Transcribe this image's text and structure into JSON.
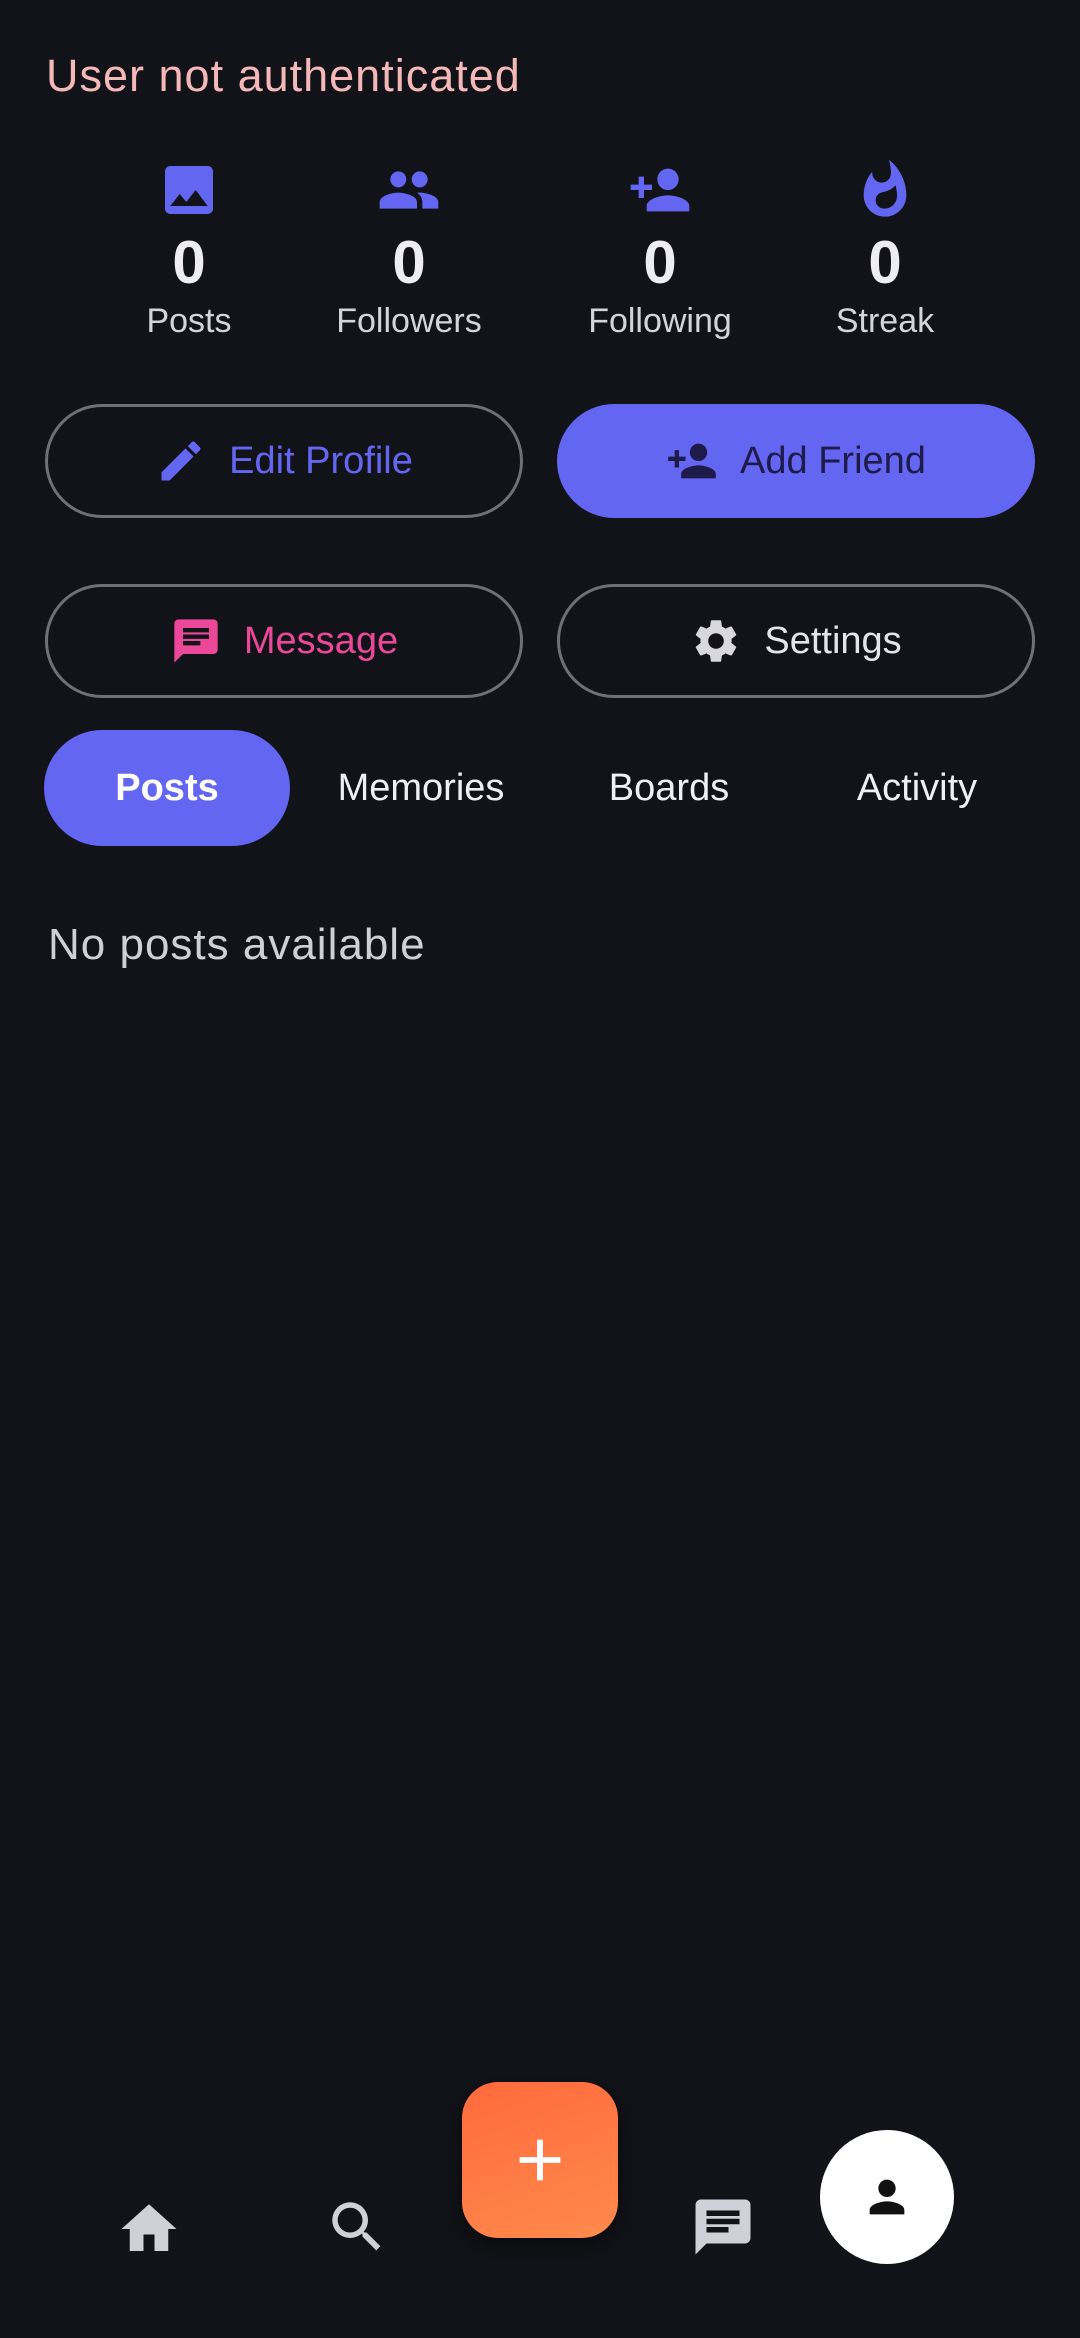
{
  "status": {
    "auth_message": "User not authenticated"
  },
  "stats": [
    {
      "icon": "image-icon",
      "value": "0",
      "label": "Posts"
    },
    {
      "icon": "people-icon",
      "value": "0",
      "label": "Followers"
    },
    {
      "icon": "person-add-icon",
      "value": "0",
      "label": "Following"
    },
    {
      "icon": "fire-icon",
      "value": "0",
      "label": "Streak"
    }
  ],
  "actions": {
    "edit_profile": "Edit Profile",
    "add_friend": "Add Friend",
    "message": "Message",
    "settings": "Settings"
  },
  "tabs": [
    {
      "label": "Posts",
      "active": true
    },
    {
      "label": "Memories",
      "active": false
    },
    {
      "label": "Boards",
      "active": false
    },
    {
      "label": "Activity",
      "active": false
    }
  ],
  "content": {
    "empty_text": "No posts available"
  },
  "bottom_nav": {
    "items": [
      "home-icon",
      "search-icon",
      "add-icon",
      "chat-icon",
      "profile-icon"
    ]
  },
  "colors": {
    "background": "#121318",
    "accent": "#6366f1",
    "auth_message": "#f4b8b8",
    "message": "#ec4899",
    "fab": "#ff6a3d"
  }
}
